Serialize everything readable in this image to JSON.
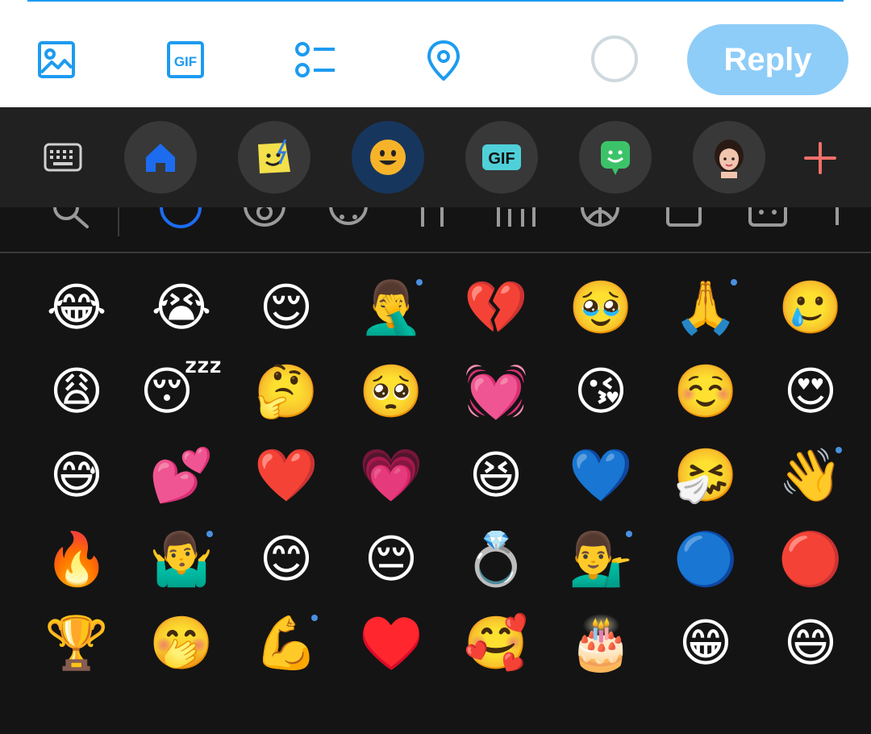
{
  "compose_toolbar": {
    "icons": [
      "image-icon",
      "gif-icon",
      "poll-icon",
      "location-pin-icon"
    ],
    "gif_text": "GIF",
    "reply_label": "Reply",
    "accent": "#1d9bf0",
    "reply_bg": "#8ecdf8"
  },
  "keyboard_strip": {
    "tools": [
      {
        "name": "keyboard-icon"
      },
      {
        "name": "home-icon"
      },
      {
        "name": "sticker-icon"
      },
      {
        "name": "emoji-icon",
        "active": true
      },
      {
        "name": "gif-icon",
        "text": "GIF"
      },
      {
        "name": "bitmoji-icon"
      },
      {
        "name": "avatar-icon"
      },
      {
        "name": "add-icon"
      }
    ],
    "active_color": "#17365e"
  },
  "category_row": {
    "icons": [
      "search-icon",
      "recent-icon",
      "smileys-icon",
      "animals-icon",
      "food-icon",
      "travel-icon",
      "activity-icon",
      "objects-icon",
      "symbols-icon",
      "flags-icon"
    ]
  },
  "emoji_grid": [
    {
      "char": "😂"
    },
    {
      "char": "😭"
    },
    {
      "char": "😌"
    },
    {
      "char": "🤦‍♂️",
      "variant_dot": true
    },
    {
      "char": "💔"
    },
    {
      "char": "🥹"
    },
    {
      "char": "🙏",
      "variant_dot": true
    },
    {
      "char": "🥲"
    },
    {
      "char": "😩"
    },
    {
      "char": "😴"
    },
    {
      "char": "🤔"
    },
    {
      "char": "🥺"
    },
    {
      "char": "💓"
    },
    {
      "char": "😘"
    },
    {
      "char": "☺️"
    },
    {
      "char": "😍"
    },
    {
      "char": "😅"
    },
    {
      "char": "💕"
    },
    {
      "char": "❤️"
    },
    {
      "char": "💗"
    },
    {
      "char": "😆"
    },
    {
      "char": "💙"
    },
    {
      "char": "🤧"
    },
    {
      "char": "👋",
      "variant_dot": true
    },
    {
      "char": "🔥"
    },
    {
      "char": "🤷‍♂️",
      "variant_dot": true
    },
    {
      "char": "😊"
    },
    {
      "char": "😔"
    },
    {
      "char": "💍"
    },
    {
      "char": "💁‍♂️",
      "variant_dot": true
    },
    {
      "char": "🔵"
    },
    {
      "char": "🔴"
    },
    {
      "char": "🏆"
    },
    {
      "char": "🤭"
    },
    {
      "char": "💪",
      "variant_dot": true
    },
    {
      "char": "♥️"
    },
    {
      "char": "🥰"
    },
    {
      "char": "🎂"
    },
    {
      "char": "😁"
    },
    {
      "char": "😄"
    }
  ]
}
